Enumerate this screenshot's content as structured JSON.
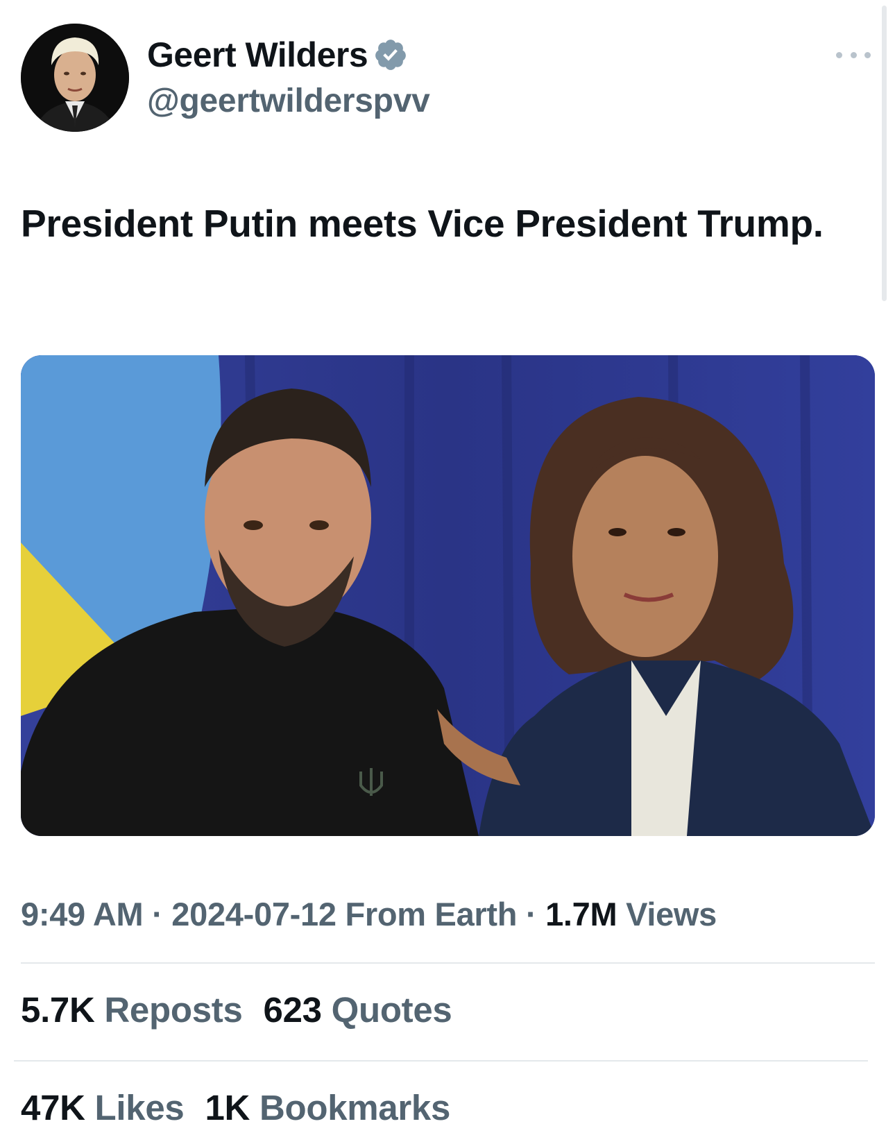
{
  "author": {
    "name": "Geert Wilders",
    "handle": "@geertwilderspvv",
    "verified_color": "#829aab"
  },
  "tweet": {
    "text": "President Putin meets Vice President Trump."
  },
  "meta": {
    "time": "9:49 AM",
    "date": "2024-07-12",
    "source": "From Earth",
    "separator": "·",
    "views_count": "1.7M",
    "views_label": "Views"
  },
  "stats": {
    "reposts_count": "5.7K",
    "reposts_label": "Reposts",
    "quotes_count": "623",
    "quotes_label": "Quotes",
    "likes_count": "47K",
    "likes_label": "Likes",
    "bookmarks_count": "1K",
    "bookmarks_label": "Bookmarks"
  },
  "icons": {
    "more": "more-horizontal-icon",
    "verified": "verified-badge-icon"
  },
  "colors": {
    "text_primary": "#0f1419",
    "text_secondary": "#536471",
    "divider": "#e4e8eb"
  }
}
